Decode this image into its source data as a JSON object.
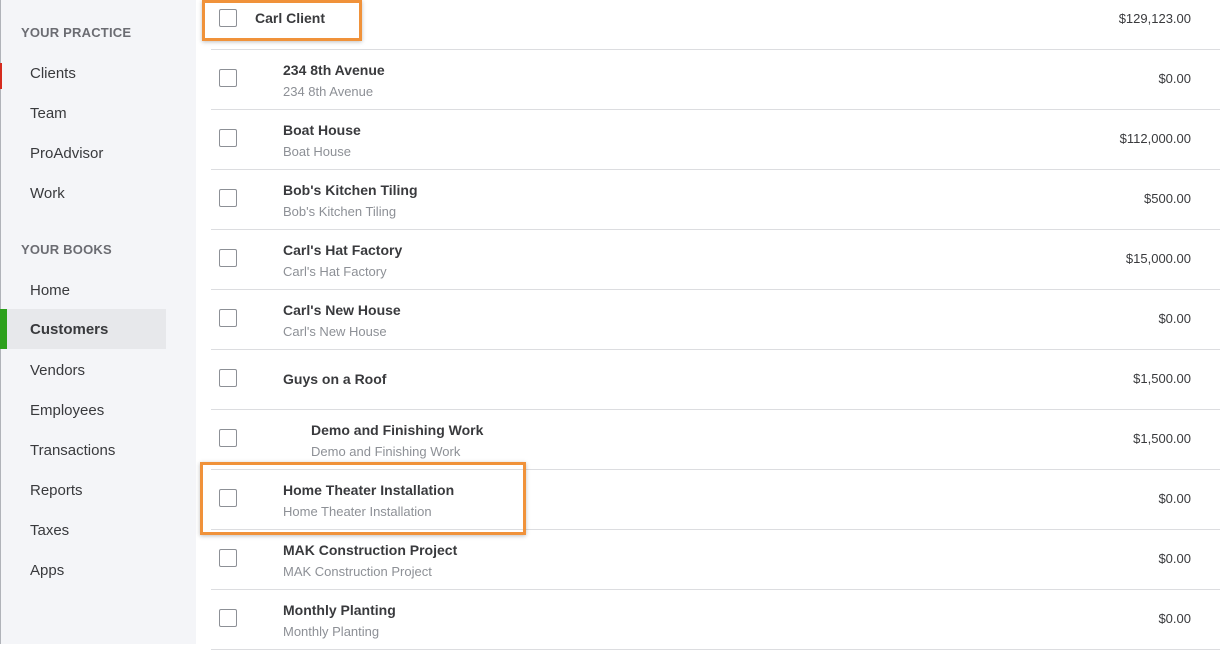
{
  "sidebar": {
    "practice_heading": "YOUR PRACTICE",
    "practice_items": [
      {
        "label": "Clients"
      },
      {
        "label": "Team"
      },
      {
        "label": "ProAdvisor"
      },
      {
        "label": "Work"
      }
    ],
    "books_heading": "YOUR BOOKS",
    "books_items": [
      {
        "label": "Home"
      },
      {
        "label": "Customers"
      },
      {
        "label": "Vendors"
      },
      {
        "label": "Employees"
      },
      {
        "label": "Transactions"
      },
      {
        "label": "Reports"
      },
      {
        "label": "Taxes"
      },
      {
        "label": "Apps"
      }
    ],
    "active_item": "Customers",
    "active_color": "#2ca01c"
  },
  "customers": [
    {
      "name": "Carl Client",
      "sub": "",
      "amount": "$129,123.00",
      "highlighted": true
    },
    {
      "name": "234 8th Avenue",
      "sub": "234 8th Avenue",
      "amount": "$0.00"
    },
    {
      "name": "Boat House",
      "sub": "Boat House",
      "amount": "$112,000.00"
    },
    {
      "name": "Bob's Kitchen Tiling",
      "sub": "Bob's Kitchen Tiling",
      "amount": "$500.00"
    },
    {
      "name": "Carl's Hat Factory",
      "sub": "Carl's Hat Factory",
      "amount": "$15,000.00"
    },
    {
      "name": "Carl's New House",
      "sub": "Carl's New House",
      "amount": "$0.00"
    },
    {
      "name": "Guys on a Roof",
      "sub": "",
      "amount": "$1,500.00"
    },
    {
      "name": "Demo and Finishing Work",
      "sub": "Demo and Finishing Work",
      "amount": "$1,500.00"
    },
    {
      "name": "Home Theater Installation",
      "sub": "Home Theater Installation",
      "amount": "$0.00",
      "highlighted": true
    },
    {
      "name": "MAK Construction Project",
      "sub": "MAK Construction Project",
      "amount": "$0.00"
    },
    {
      "name": "Monthly Planting",
      "sub": "Monthly Planting",
      "amount": "$0.00"
    }
  ],
  "highlight_color": "#f0923a"
}
